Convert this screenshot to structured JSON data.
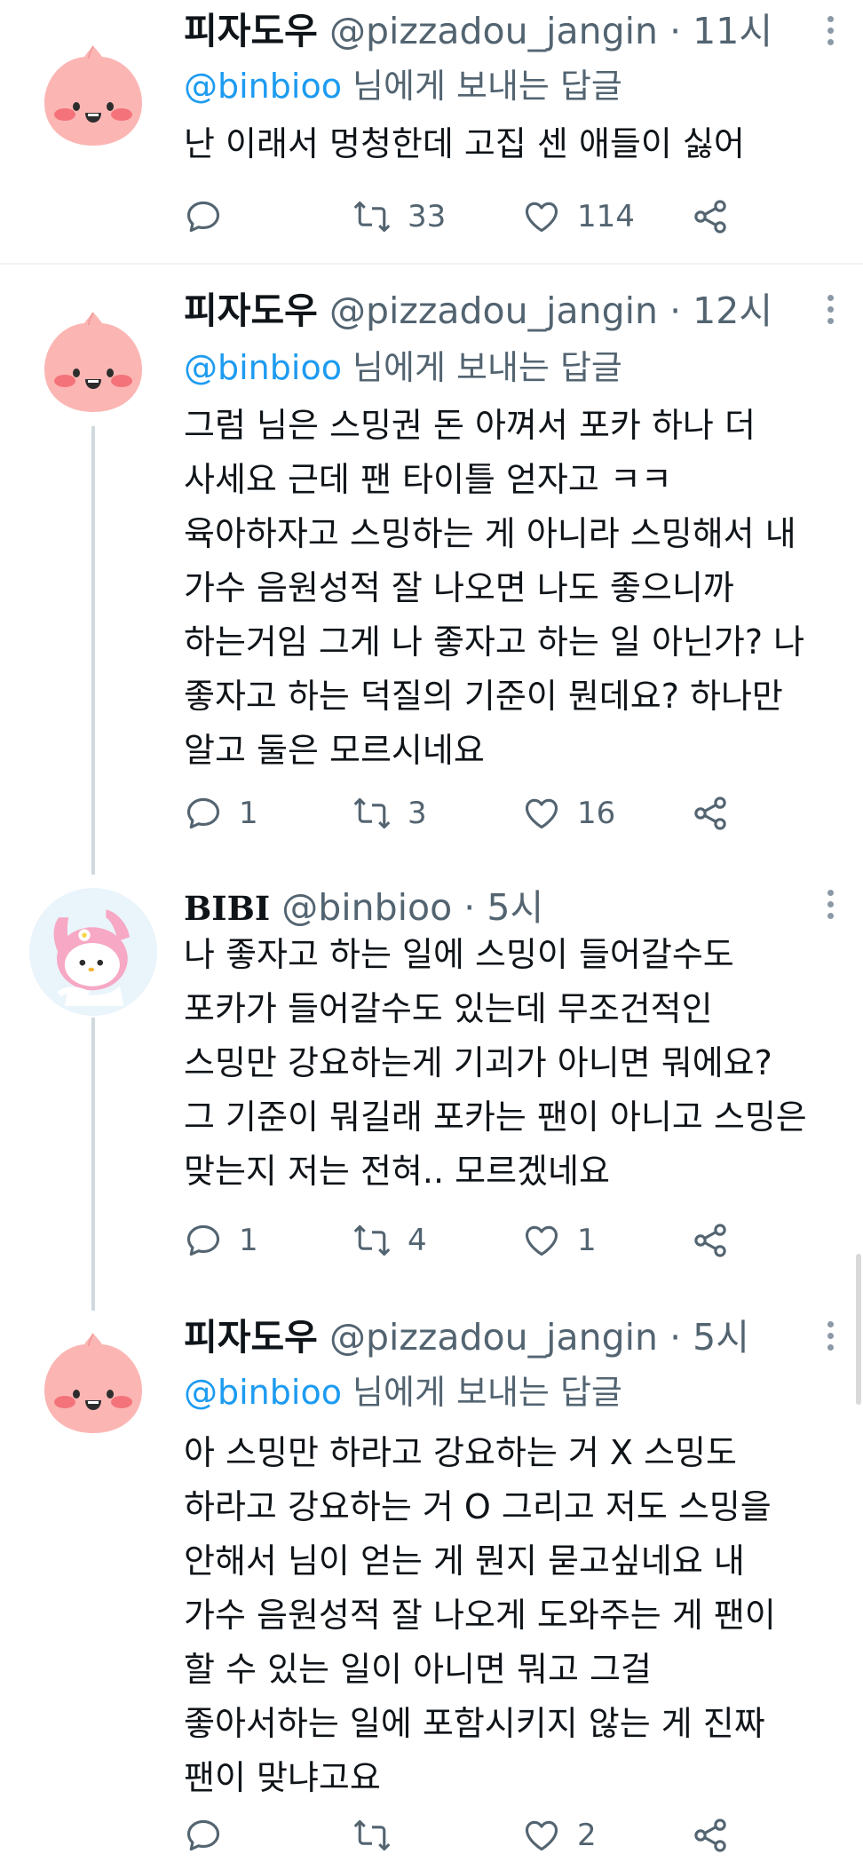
{
  "tweets": [
    {
      "name": "피자도우",
      "handle": "@pizzadou_jangin",
      "sep": "·",
      "time": "11시",
      "reply_prefix": "@binbioo",
      "reply_suffix": " 님에게 보내는 답글",
      "lines": [
        "난 이래서 멍청한데 고집 센 애들이 싫어"
      ],
      "reply_count": "",
      "retweet_count": "33",
      "like_count": "114"
    },
    {
      "name": "피자도우",
      "handle": "@pizzadou_jangin",
      "sep": "·",
      "time": "12시",
      "reply_prefix": "@binbioo",
      "reply_suffix": " 님에게 보내는 답글",
      "lines": [
        "그럼 님은 스밍권 돈 아껴서 포카 하나 더",
        "사세요 근데 팬 타이틀 얻자고 ㅋㅋ",
        "육아하자고 스밍하는 게 아니라 스밍해서 내",
        "가수 음원성적 잘 나오면 나도 좋으니까",
        "하는거임 그게 나 좋자고 하는 일 아닌가? 나",
        "좋자고 하는 덕질의 기준이 뭔데요? 하나만",
        "알고 둘은 모르시네요"
      ],
      "reply_count": "1",
      "retweet_count": "3",
      "like_count": "16"
    },
    {
      "name": "BIBI",
      "handle": "@binbioo",
      "sep": "·",
      "time": "5시",
      "lines": [
        "나 좋자고 하는 일에 스밍이 들어갈수도",
        "포카가 들어갈수도 있는데 무조건적인",
        "스밍만 강요하는게 기괴가 아니면 뭐에요?",
        "그 기준이 뭐길래 포카는 팬이 아니고 스밍은",
        "맞는지 저는 전혀.. 모르겠네요"
      ],
      "reply_count": "1",
      "retweet_count": "4",
      "like_count": "1"
    },
    {
      "name": "피자도우",
      "handle": "@pizzadou_jangin",
      "sep": "·",
      "time": "5시",
      "reply_prefix": "@binbioo",
      "reply_suffix": " 님에게 보내는 답글",
      "lines": [
        "아 스밍만 하라고 강요하는 거 X 스밍도",
        "하라고 강요하는 거 O 그리고 저도 스밍을",
        "안해서 님이 얻는 게 뭔지 묻고싶네요 내",
        "가수 음원성적 잘 나오게 도와주는 게 팬이",
        "할 수 있는 일이 아니면 뭐고 그걸",
        "좋아서하는 일에 포함시키지 않는 게 진짜",
        "팬이 맞냐고요"
      ],
      "reply_count": "",
      "retweet_count": "",
      "like_count": "2"
    }
  ],
  "icons": {
    "reply": "comment-bubble-icon",
    "retweet": "retweet-icon",
    "like": "heart-icon",
    "share": "share-icon",
    "more": "more-dots-icon"
  },
  "colors": {
    "link": "#1d9bf0",
    "secondary": "#536471",
    "text": "#0f1419",
    "apeach": "#f9a7a7"
  }
}
